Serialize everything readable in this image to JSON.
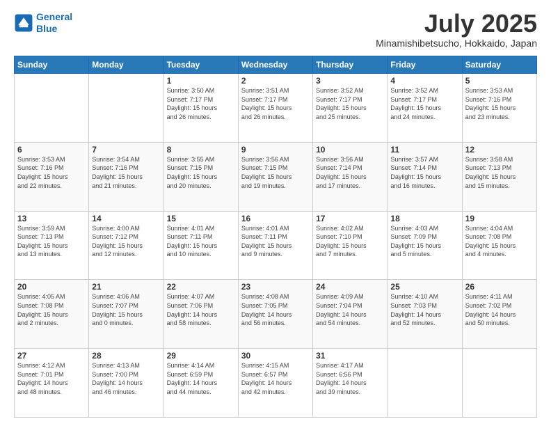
{
  "logo": {
    "line1": "General",
    "line2": "Blue"
  },
  "title": "July 2025",
  "subtitle": "Minamishibetsucho, Hokkaido, Japan",
  "days_of_week": [
    "Sunday",
    "Monday",
    "Tuesday",
    "Wednesday",
    "Thursday",
    "Friday",
    "Saturday"
  ],
  "weeks": [
    [
      {
        "day": "",
        "info": ""
      },
      {
        "day": "",
        "info": ""
      },
      {
        "day": "1",
        "info": "Sunrise: 3:50 AM\nSunset: 7:17 PM\nDaylight: 15 hours\nand 26 minutes."
      },
      {
        "day": "2",
        "info": "Sunrise: 3:51 AM\nSunset: 7:17 PM\nDaylight: 15 hours\nand 26 minutes."
      },
      {
        "day": "3",
        "info": "Sunrise: 3:52 AM\nSunset: 7:17 PM\nDaylight: 15 hours\nand 25 minutes."
      },
      {
        "day": "4",
        "info": "Sunrise: 3:52 AM\nSunset: 7:17 PM\nDaylight: 15 hours\nand 24 minutes."
      },
      {
        "day": "5",
        "info": "Sunrise: 3:53 AM\nSunset: 7:16 PM\nDaylight: 15 hours\nand 23 minutes."
      }
    ],
    [
      {
        "day": "6",
        "info": "Sunrise: 3:53 AM\nSunset: 7:16 PM\nDaylight: 15 hours\nand 22 minutes."
      },
      {
        "day": "7",
        "info": "Sunrise: 3:54 AM\nSunset: 7:16 PM\nDaylight: 15 hours\nand 21 minutes."
      },
      {
        "day": "8",
        "info": "Sunrise: 3:55 AM\nSunset: 7:15 PM\nDaylight: 15 hours\nand 20 minutes."
      },
      {
        "day": "9",
        "info": "Sunrise: 3:56 AM\nSunset: 7:15 PM\nDaylight: 15 hours\nand 19 minutes."
      },
      {
        "day": "10",
        "info": "Sunrise: 3:56 AM\nSunset: 7:14 PM\nDaylight: 15 hours\nand 17 minutes."
      },
      {
        "day": "11",
        "info": "Sunrise: 3:57 AM\nSunset: 7:14 PM\nDaylight: 15 hours\nand 16 minutes."
      },
      {
        "day": "12",
        "info": "Sunrise: 3:58 AM\nSunset: 7:13 PM\nDaylight: 15 hours\nand 15 minutes."
      }
    ],
    [
      {
        "day": "13",
        "info": "Sunrise: 3:59 AM\nSunset: 7:13 PM\nDaylight: 15 hours\nand 13 minutes."
      },
      {
        "day": "14",
        "info": "Sunrise: 4:00 AM\nSunset: 7:12 PM\nDaylight: 15 hours\nand 12 minutes."
      },
      {
        "day": "15",
        "info": "Sunrise: 4:01 AM\nSunset: 7:11 PM\nDaylight: 15 hours\nand 10 minutes."
      },
      {
        "day": "16",
        "info": "Sunrise: 4:01 AM\nSunset: 7:11 PM\nDaylight: 15 hours\nand 9 minutes."
      },
      {
        "day": "17",
        "info": "Sunrise: 4:02 AM\nSunset: 7:10 PM\nDaylight: 15 hours\nand 7 minutes."
      },
      {
        "day": "18",
        "info": "Sunrise: 4:03 AM\nSunset: 7:09 PM\nDaylight: 15 hours\nand 5 minutes."
      },
      {
        "day": "19",
        "info": "Sunrise: 4:04 AM\nSunset: 7:08 PM\nDaylight: 15 hours\nand 4 minutes."
      }
    ],
    [
      {
        "day": "20",
        "info": "Sunrise: 4:05 AM\nSunset: 7:08 PM\nDaylight: 15 hours\nand 2 minutes."
      },
      {
        "day": "21",
        "info": "Sunrise: 4:06 AM\nSunset: 7:07 PM\nDaylight: 15 hours\nand 0 minutes."
      },
      {
        "day": "22",
        "info": "Sunrise: 4:07 AM\nSunset: 7:06 PM\nDaylight: 14 hours\nand 58 minutes."
      },
      {
        "day": "23",
        "info": "Sunrise: 4:08 AM\nSunset: 7:05 PM\nDaylight: 14 hours\nand 56 minutes."
      },
      {
        "day": "24",
        "info": "Sunrise: 4:09 AM\nSunset: 7:04 PM\nDaylight: 14 hours\nand 54 minutes."
      },
      {
        "day": "25",
        "info": "Sunrise: 4:10 AM\nSunset: 7:03 PM\nDaylight: 14 hours\nand 52 minutes."
      },
      {
        "day": "26",
        "info": "Sunrise: 4:11 AM\nSunset: 7:02 PM\nDaylight: 14 hours\nand 50 minutes."
      }
    ],
    [
      {
        "day": "27",
        "info": "Sunrise: 4:12 AM\nSunset: 7:01 PM\nDaylight: 14 hours\nand 48 minutes."
      },
      {
        "day": "28",
        "info": "Sunrise: 4:13 AM\nSunset: 7:00 PM\nDaylight: 14 hours\nand 46 minutes."
      },
      {
        "day": "29",
        "info": "Sunrise: 4:14 AM\nSunset: 6:59 PM\nDaylight: 14 hours\nand 44 minutes."
      },
      {
        "day": "30",
        "info": "Sunrise: 4:15 AM\nSunset: 6:57 PM\nDaylight: 14 hours\nand 42 minutes."
      },
      {
        "day": "31",
        "info": "Sunrise: 4:17 AM\nSunset: 6:56 PM\nDaylight: 14 hours\nand 39 minutes."
      },
      {
        "day": "",
        "info": ""
      },
      {
        "day": "",
        "info": ""
      }
    ]
  ]
}
